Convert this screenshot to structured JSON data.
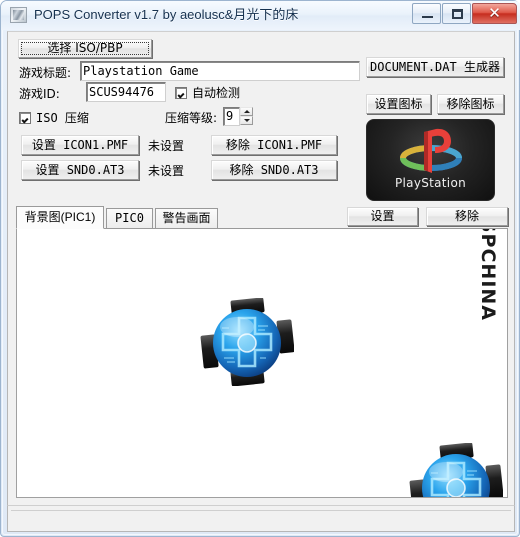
{
  "window": {
    "title": "POPS Converter v1.7 by aeolusc&月光下的床",
    "icon": "app-icon",
    "caption": {
      "minimize": "minimize-icon",
      "maximize": "maximize-icon",
      "close": "✕"
    }
  },
  "form": {
    "select_iso_button": "选择 ISO/PBP",
    "title_label": "游戏标题:",
    "title_value": "Playstation Game",
    "id_label": "游戏ID:",
    "id_value": "SCUS94476",
    "auto_detect_label": "自动检测",
    "auto_detect_checked": true,
    "iso_compress_label": "ISO 压缩",
    "iso_compress_checked": true,
    "compress_level_label": "压缩等级:",
    "compress_level_value": "9",
    "set_icon1_button": "设置 ICON1.PMF",
    "icon1_status": "未设置",
    "remove_icon1_button": "移除 ICON1.PMF",
    "set_snd0_button": "设置 SND0.AT3",
    "snd0_status": "未设置",
    "remove_snd0_button": "移除 SND0.AT3",
    "document_dat_button": "DOCUMENT.DAT 生成器",
    "set_icon_button": "设置图标",
    "remove_icon_button": "移除图标"
  },
  "preview": {
    "logo_word": "PlayStation",
    "watermark": "PSPCHINA"
  },
  "tabs": {
    "items": [
      {
        "label": "背景图(PIC1)",
        "active": true,
        "mono": false
      },
      {
        "label": "PIC0",
        "active": false,
        "mono": true
      },
      {
        "label": "警告画面",
        "active": false,
        "mono": false
      }
    ],
    "set_button": "设置",
    "remove_button": "移除"
  },
  "colors": {
    "window_border": "#9cb4cf",
    "title_text": "#16314f",
    "close_button": "#c62d1f",
    "client_bg": "#f1f1f1",
    "panel_bg": "#ffffff",
    "dpad_blue": "#29a8e8",
    "logo_red": "#e8403a"
  }
}
